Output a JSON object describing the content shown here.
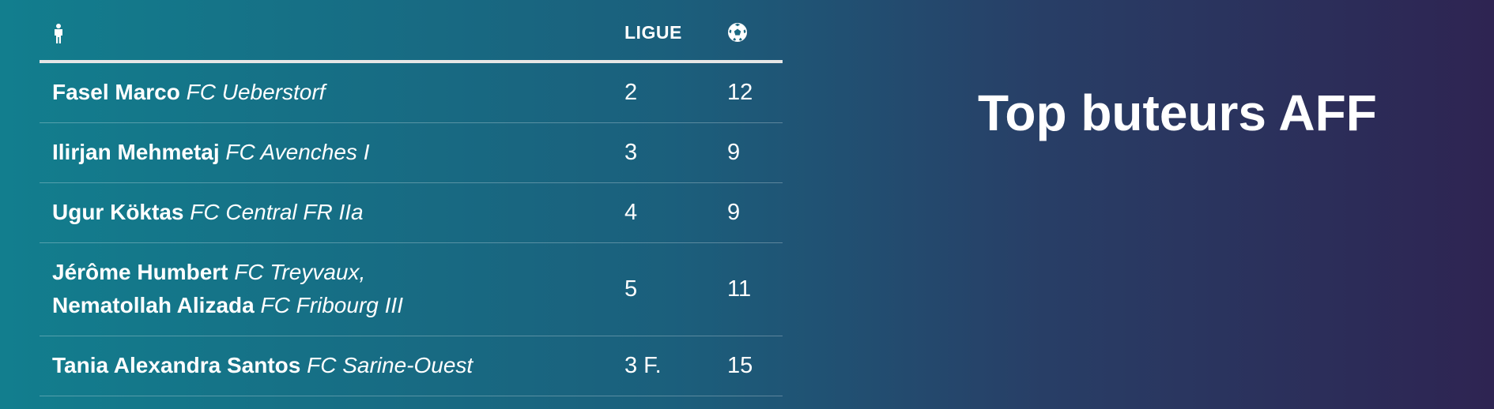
{
  "title": "Top buteurs AFF",
  "table": {
    "columns": {
      "player_icon": "person-icon",
      "league_label": "LIGUE",
      "goals_icon": "soccer-ball-icon"
    },
    "rows": [
      {
        "players": [
          {
            "name": "Fasel Marco",
            "club": "FC Ueberstorf"
          }
        ],
        "league": "2",
        "goals": "12"
      },
      {
        "players": [
          {
            "name": "Ilirjan Mehmetaj",
            "club": "FC Avenches I"
          }
        ],
        "league": "3",
        "goals": "9"
      },
      {
        "players": [
          {
            "name": "Ugur Köktas",
            "club": "FC Central FR IIa"
          }
        ],
        "league": "4",
        "goals": "9"
      },
      {
        "players": [
          {
            "name": "Jérôme Humbert",
            "club": "FC Treyvaux,"
          },
          {
            "name": "Nematollah Alizada",
            "club": "FC Fribourg III"
          }
        ],
        "league": "5",
        "goals": "11"
      },
      {
        "players": [
          {
            "name": "Tania Alexandra Santos",
            "club": "FC Sarine-Ouest"
          }
        ],
        "league": "3 F.",
        "goals": "15"
      }
    ]
  }
}
